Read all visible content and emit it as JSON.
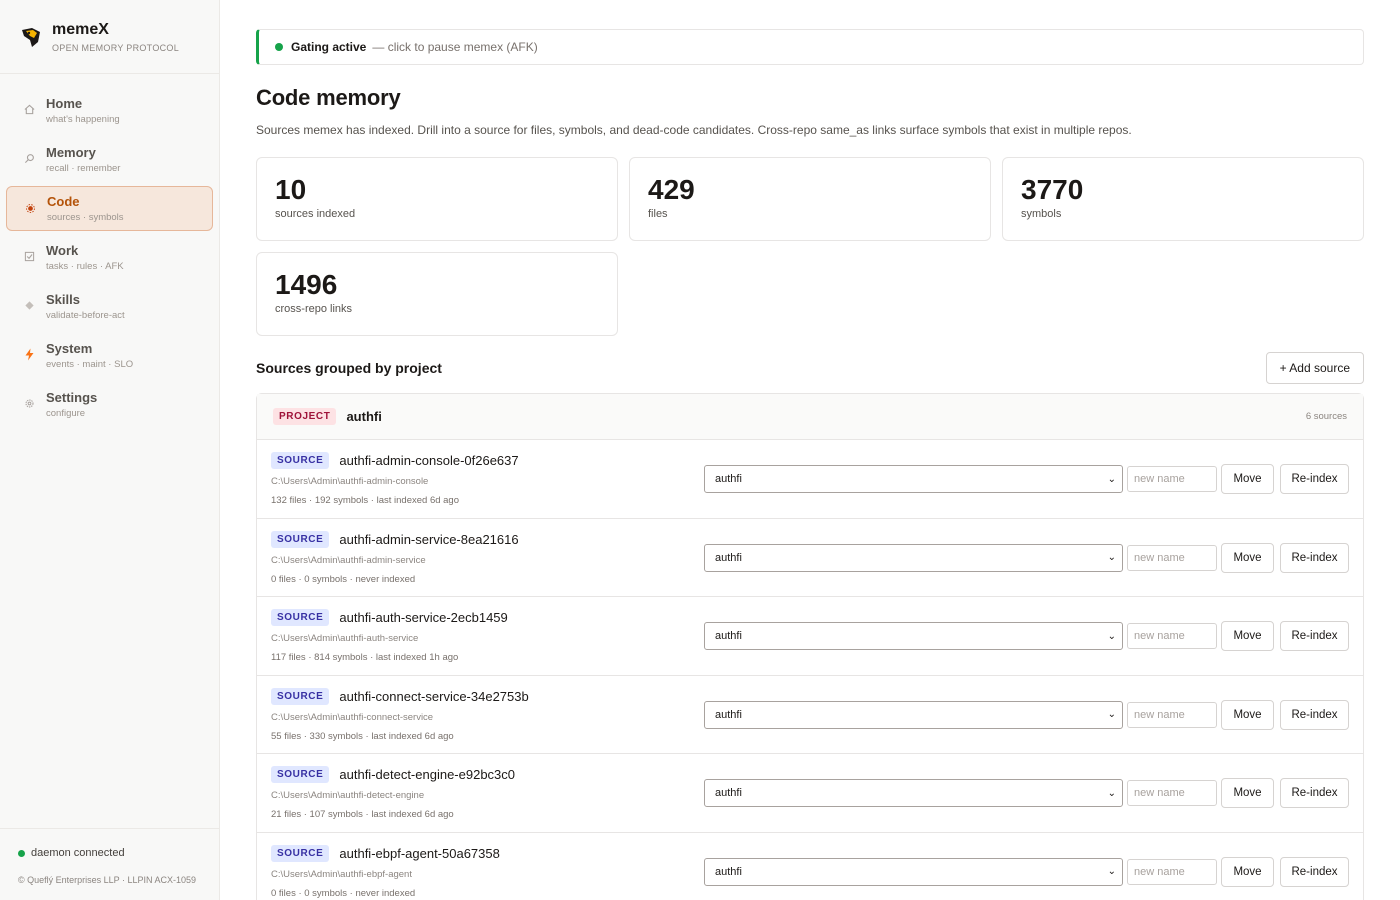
{
  "brand": {
    "name": "memeX",
    "subtitle": "OPEN MEMORY PROTOCOL",
    "logo_icon": "bird-logo-icon"
  },
  "nav": [
    {
      "id": "home",
      "label": "Home",
      "sub": "what's happening",
      "icon": "home-icon",
      "active": false
    },
    {
      "id": "memory",
      "label": "Memory",
      "sub": "recall · remember",
      "icon": "search-icon",
      "active": false
    },
    {
      "id": "code",
      "label": "Code",
      "sub": "sources · symbols",
      "icon": "code-icon",
      "active": true
    },
    {
      "id": "work",
      "label": "Work",
      "sub": "tasks · rules · AFK",
      "icon": "checkbox-icon",
      "active": false
    },
    {
      "id": "skills",
      "label": "Skills",
      "sub": "validate-before-act",
      "icon": "diamond-icon",
      "active": false
    },
    {
      "id": "system",
      "label": "System",
      "sub": "events · maint · SLO",
      "icon": "lightning-icon",
      "active": false
    },
    {
      "id": "settings",
      "label": "Settings",
      "sub": "configure",
      "icon": "gear-icon",
      "active": false
    }
  ],
  "footer": {
    "status": "daemon connected",
    "copyright": "© Queflý Enterprises LLP · LLPIN ACX-1059"
  },
  "gating": {
    "label": "Gating active",
    "hint": "— click to pause memex (AFK)"
  },
  "page": {
    "title": "Code memory",
    "description": "Sources memex has indexed. Drill into a source for files, symbols, and dead-code candidates. Cross-repo same_as links surface symbols that exist in multiple repos."
  },
  "stats": [
    {
      "value": "10",
      "label": "sources indexed"
    },
    {
      "value": "429",
      "label": "files"
    },
    {
      "value": "3770",
      "label": "symbols"
    },
    {
      "value": "1496",
      "label": "cross-repo links"
    }
  ],
  "sources_section": {
    "title": "Sources grouped by project",
    "add_label": "+ Add source"
  },
  "project": {
    "tag": "PROJECT",
    "name": "authfi",
    "count": "6 sources"
  },
  "row_labels": {
    "tag": "SOURCE",
    "placeholder": "new name",
    "move": "Move",
    "reindex": "Re-index"
  },
  "sources": [
    {
      "name": "authfi-admin-console-0f26e637",
      "path": "C:\\Users\\Admin\\authfi-admin-console",
      "meta": "132 files · 192 symbols · last indexed 6d ago",
      "project": "authfi"
    },
    {
      "name": "authfi-admin-service-8ea21616",
      "path": "C:\\Users\\Admin\\authfi-admin-service",
      "meta": "0 files · 0 symbols · never indexed",
      "project": "authfi"
    },
    {
      "name": "authfi-auth-service-2ecb1459",
      "path": "C:\\Users\\Admin\\authfi-auth-service",
      "meta": "117 files · 814 symbols · last indexed 1h ago",
      "project": "authfi"
    },
    {
      "name": "authfi-connect-service-34e2753b",
      "path": "C:\\Users\\Admin\\authfi-connect-service",
      "meta": "55 files · 330 symbols · last indexed 6d ago",
      "project": "authfi"
    },
    {
      "name": "authfi-detect-engine-e92bc3c0",
      "path": "C:\\Users\\Admin\\authfi-detect-engine",
      "meta": "21 files · 107 symbols · last indexed 6d ago",
      "project": "authfi"
    },
    {
      "name": "authfi-ebpf-agent-50a67358",
      "path": "C:\\Users\\Admin\\authfi-ebpf-agent",
      "meta": "0 files · 0 symbols · never indexed",
      "project": "authfi"
    }
  ],
  "colors": {
    "accent": "#b45309",
    "active_bg": "#f6e7dc",
    "status_green": "#16a34a",
    "project_tag_bg": "#fde2e4",
    "source_tag_bg": "#e0e7ff"
  }
}
